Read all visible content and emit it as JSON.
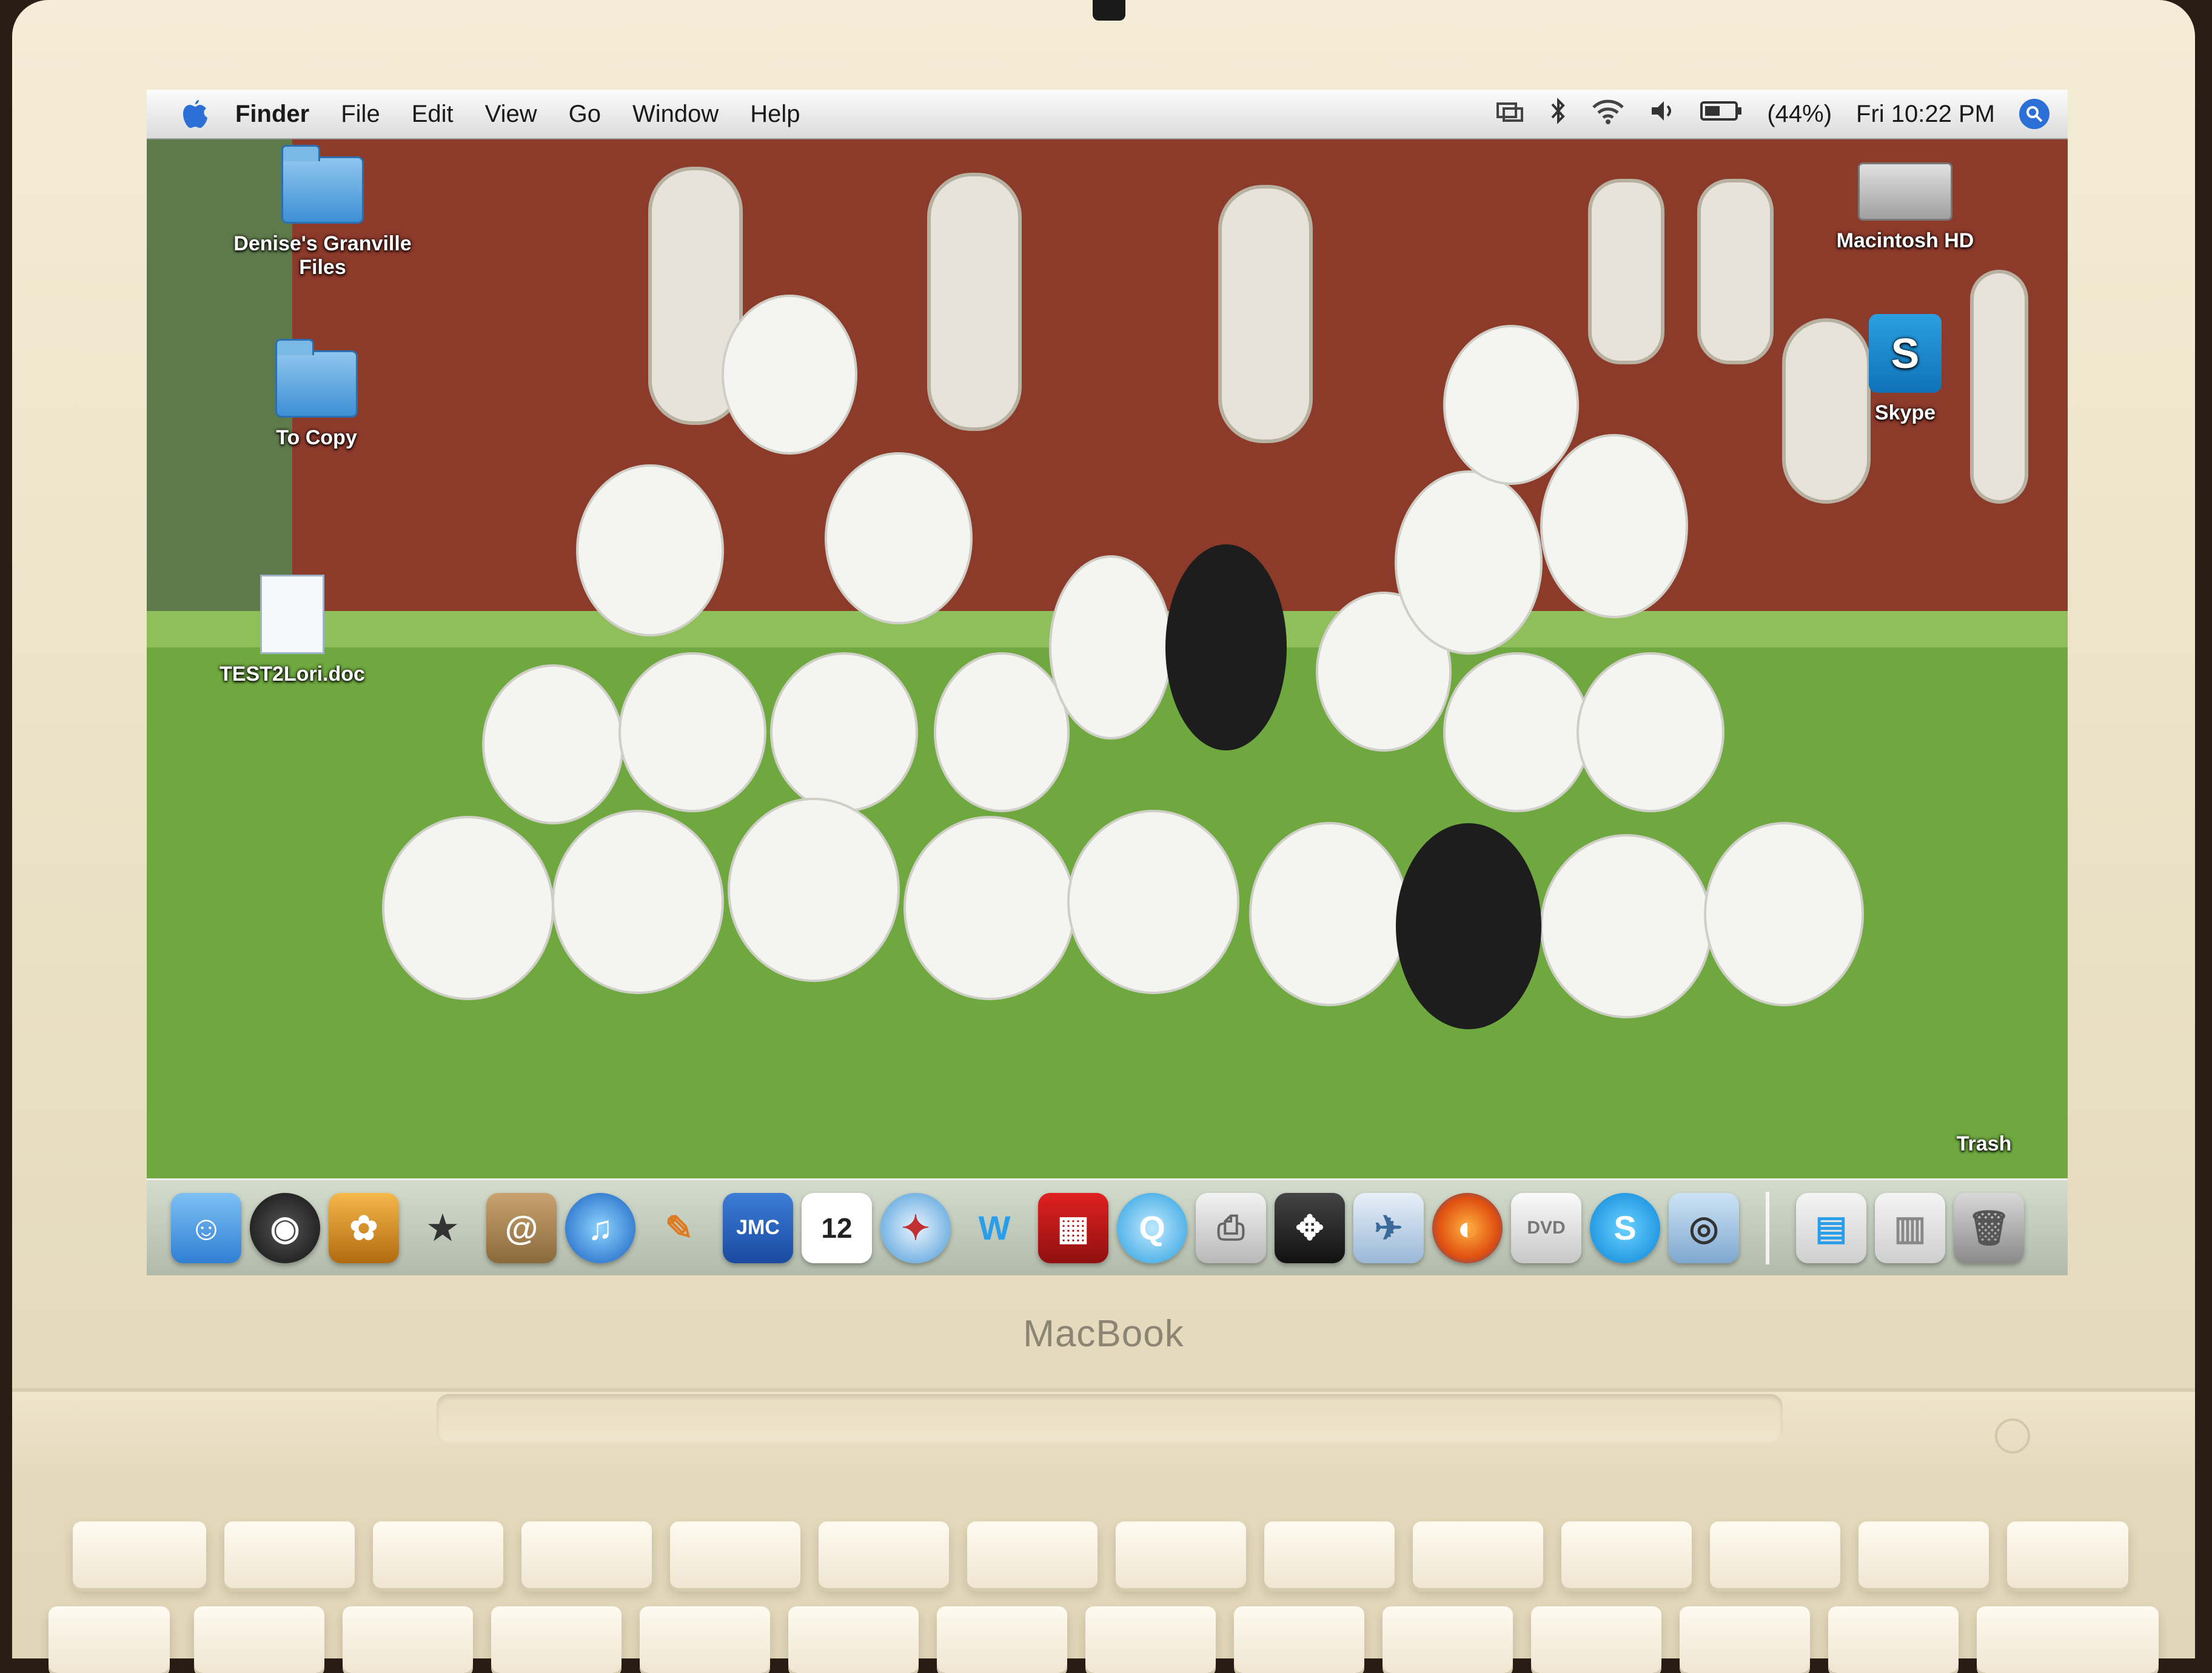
{
  "menubar": {
    "app_name": "Finder",
    "menus": [
      "File",
      "Edit",
      "View",
      "Go",
      "Window",
      "Help"
    ],
    "battery": "(44%)",
    "clock": "Fri 10:22 PM"
  },
  "desktop_icons": {
    "folder1": "Denise's Granville Files",
    "folder2": "To Copy",
    "document": "TEST2Lori.doc",
    "disk": "Macintosh HD",
    "skype": "Skype",
    "trash": "Trash"
  },
  "dock": {
    "ical_day": "12",
    "jmc_label": "JMC",
    "items": [
      "finder-icon",
      "dashboard-icon",
      "iphoto-icon",
      "imovie-icon",
      "address-book-icon",
      "itunes-icon",
      "pages-icon",
      "jmc-icon",
      "ical-icon",
      "safari-icon",
      "iweb-icon",
      "photo-booth-icon",
      "quicktime-icon",
      "printer-icon",
      "expose-icon",
      "preview-icon",
      "firefox-icon",
      "dvd-player-icon",
      "skype-icon",
      "iphoto-camera-icon",
      "documents-stack-icon",
      "downloads-stack-icon",
      "trash-icon"
    ]
  },
  "laptop": {
    "brand": "MacBook"
  }
}
